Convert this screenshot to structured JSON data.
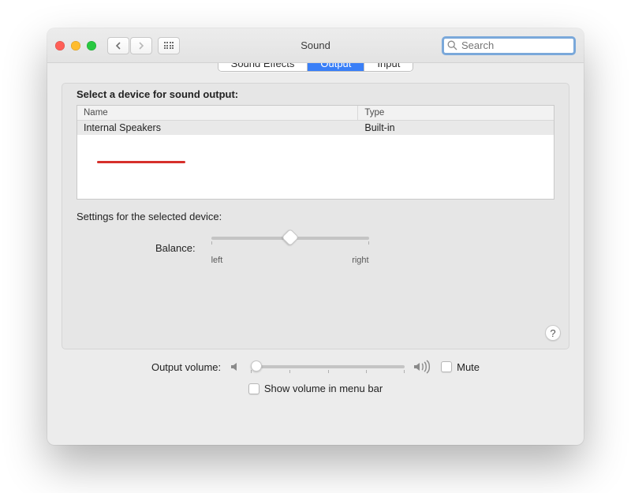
{
  "window": {
    "title": "Sound"
  },
  "search": {
    "placeholder": "Search",
    "value": ""
  },
  "tabs": {
    "effects": "Sound Effects",
    "output": "Output",
    "input": "Input",
    "active": "output"
  },
  "output": {
    "select_label": "Select a device for sound output:",
    "col_name": "Name",
    "col_type": "Type",
    "devices": [
      {
        "name": "Internal Speakers",
        "type": "Built-in"
      }
    ]
  },
  "balance": {
    "section_label": "Settings for the selected device:",
    "label": "Balance:",
    "left_label": "left",
    "right_label": "right",
    "value": 0.5
  },
  "volume": {
    "label": "Output volume:",
    "mute_label": "Mute",
    "mute_checked": false,
    "menubar_label": "Show volume in menu bar",
    "menubar_checked": false,
    "value": 0.03
  },
  "help_char": "?"
}
